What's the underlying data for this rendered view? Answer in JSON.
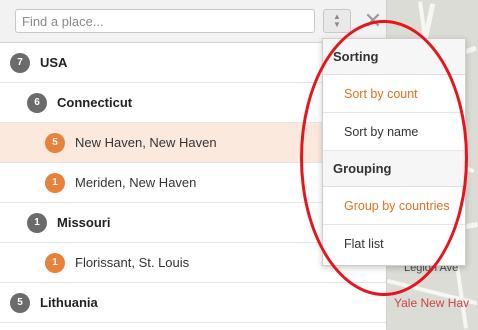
{
  "search": {
    "placeholder": "Find a place..."
  },
  "toolbar": {
    "sort_icon": "sort-updown-icon",
    "close_icon": "close-icon"
  },
  "list": [
    {
      "count": "7",
      "label": "USA",
      "level": 0,
      "bold": true,
      "badge": "gray"
    },
    {
      "count": "6",
      "label": "Connecticut",
      "level": 1,
      "bold": true,
      "badge": "gray"
    },
    {
      "count": "5",
      "label": "New Haven, New Haven",
      "level": 2,
      "bold": false,
      "badge": "orange",
      "highlight": true
    },
    {
      "count": "1",
      "label": "Meriden, New Haven",
      "level": 2,
      "bold": false,
      "badge": "orange"
    },
    {
      "count": "1",
      "label": "Missouri",
      "level": 1,
      "bold": true,
      "badge": "gray"
    },
    {
      "count": "1",
      "label": "Florissant, St. Louis",
      "level": 2,
      "bold": false,
      "badge": "orange"
    },
    {
      "count": "5",
      "label": "Lithuania",
      "level": 0,
      "bold": true,
      "badge": "gray"
    }
  ],
  "menu": {
    "sorting_heading": "Sorting",
    "sort_by_count": "Sort by count",
    "sort_by_name": "Sort by name",
    "grouping_heading": "Grouping",
    "group_by_countries": "Group by countries",
    "flat_list": "Flat list"
  },
  "map": {
    "label_legion": "Legion Ave",
    "label_yale": "Yale New Hav"
  },
  "colors": {
    "accent": "#e2711d",
    "badge_gray": "#6b6b6b",
    "badge_orange": "#e8823a",
    "highlight": "#fbe9de",
    "annotation": "#e8141c"
  }
}
